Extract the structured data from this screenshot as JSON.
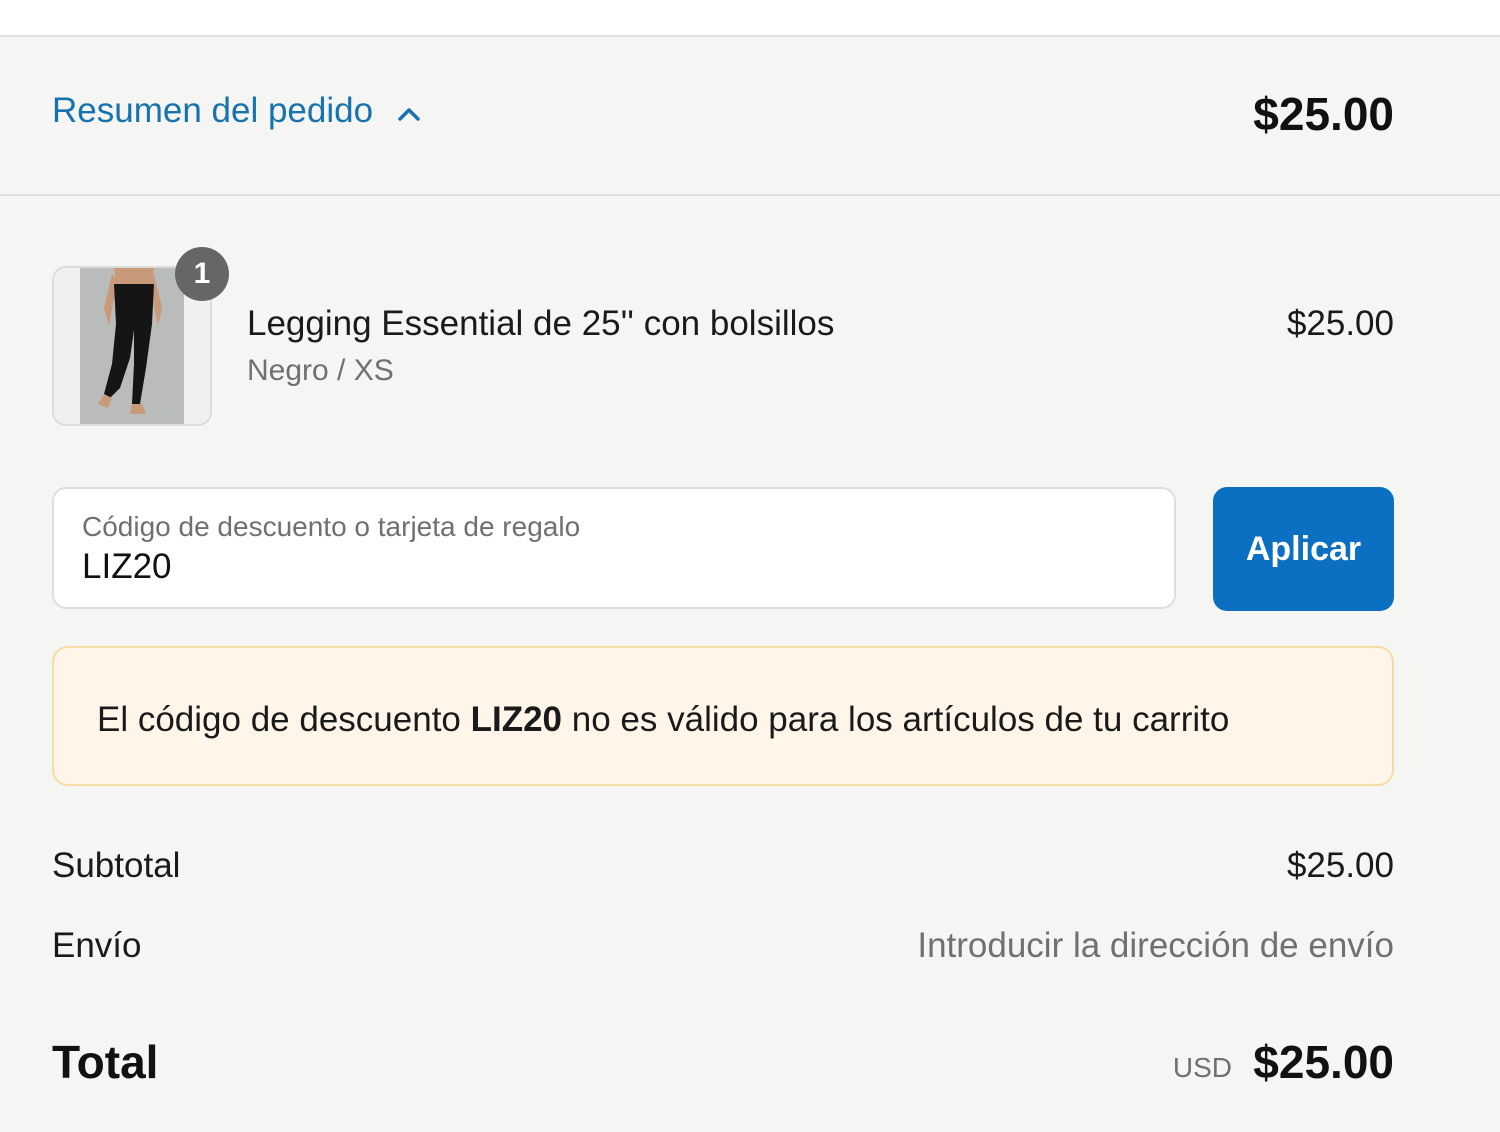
{
  "summary": {
    "toggle_label": "Resumen del pedido",
    "toggle_icon": "chevron-up-icon",
    "header_total": "$25.00",
    "link_color": "#1773b0"
  },
  "product": {
    "quantity": "1",
    "name": "Legging Essential de 25'' con bolsillos",
    "variant": "Negro / XS",
    "price": "$25.00"
  },
  "discount": {
    "label": "Código de descuento o tarjeta de regalo",
    "value": "LIZ20",
    "apply_label": "Aplicar",
    "button_color": "#0b6fc2"
  },
  "error": {
    "text_before": "El código de descuento ",
    "code": "LIZ20",
    "text_after": " no es válido para los artículos de tu carrito"
  },
  "totals": {
    "subtotal_label": "Subtotal",
    "subtotal_value": "$25.00",
    "shipping_label": "Envío",
    "shipping_value": "Introducir la dirección de envío",
    "total_label": "Total",
    "currency": "USD",
    "total_value": "$25.00"
  }
}
